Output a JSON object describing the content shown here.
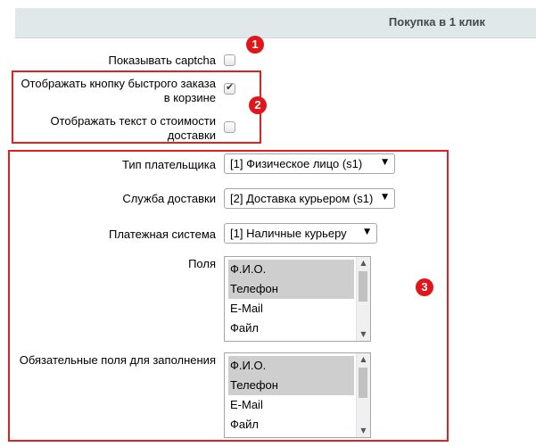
{
  "header": {
    "title": "Покупка в 1 клик"
  },
  "options": {
    "captcha": {
      "label": "Показывать captcha",
      "checked": false
    },
    "cart_button": {
      "label_line1": "Отображать кнопку быстрого заказа",
      "label_line2": "в корзине",
      "checked": true
    },
    "delivery_text": {
      "label_line1": "Отображать текст о стоимости",
      "label_line2": "доставки",
      "checked": false
    }
  },
  "settings": {
    "payer_type": {
      "label": "Тип плательщика",
      "value": "[1] Физическое лицо (s1)"
    },
    "delivery_service": {
      "label": "Служба доставки",
      "value": "[2] Доставка курьером (s1)"
    },
    "payment_system": {
      "label": "Платежная система",
      "value": "[1] Наличные курьеру"
    },
    "fields": {
      "label": "Поля",
      "options": [
        {
          "text": "Ф.И.О.",
          "selected": true
        },
        {
          "text": "Телефон",
          "selected": true
        },
        {
          "text": "E-Mail",
          "selected": false
        },
        {
          "text": "Файл",
          "selected": false
        }
      ]
    },
    "required_fields": {
      "label": "Обязательные поля для заполнения",
      "options": [
        {
          "text": "Ф.И.О.",
          "selected": true
        },
        {
          "text": "Телефон",
          "selected": true
        },
        {
          "text": "E-Mail",
          "selected": false
        },
        {
          "text": "Файл",
          "selected": false
        }
      ]
    }
  },
  "annotations": {
    "badge1": "1",
    "badge2": "2",
    "badge3": "3",
    "color": "#e0161b"
  },
  "icons": {
    "dropdown": "triangle-down-icon",
    "scroll_up": "scroll-up-icon",
    "scroll_down": "scroll-down-icon",
    "check": "checkmark-icon"
  }
}
